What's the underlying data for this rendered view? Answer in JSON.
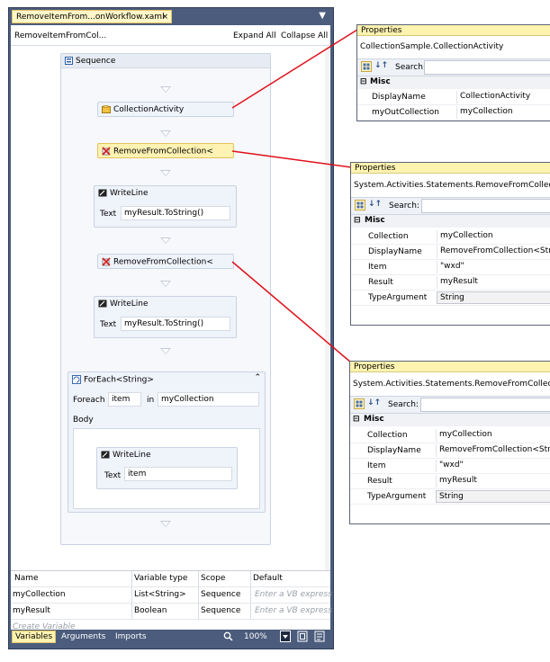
{
  "designer": {
    "tab_title": "RemoveItemFrom...onWorkflow.xaml",
    "tab_close": "×",
    "tab_dropdown": "▼",
    "breadcrumb": "RemoveItemFromCol...",
    "expand_all": "Expand All",
    "collapse_all": "Collapse All",
    "sequence_label": "Sequence",
    "activities": {
      "collection_activity": "CollectionActivity",
      "remove1": "RemoveFromCollection<",
      "writeline1": {
        "title": "WriteLine",
        "text_label": "Text",
        "text_value": "myResult.ToString()"
      },
      "remove2": "RemoveFromCollection<",
      "writeline2": {
        "title": "WriteLine",
        "text_label": "Text",
        "text_value": "myResult.ToString()"
      },
      "foreach": {
        "title": "ForEach<String>",
        "foreach_label": "Foreach",
        "item_value": "item",
        "in_label": "in",
        "collection_value": "myCollection",
        "body_label": "Body",
        "writeline": {
          "title": "WriteLine",
          "text_label": "Text",
          "text_value": "item"
        }
      }
    }
  },
  "variables": {
    "headers": [
      "Name",
      "Variable type",
      "Scope",
      "Default"
    ],
    "rows": [
      {
        "name": "myCollection",
        "type": "List<String>",
        "scope": "Sequence",
        "default": "Enter a VB express"
      },
      {
        "name": "myResult",
        "type": "Boolean",
        "scope": "Sequence",
        "default": "Enter a VB express"
      }
    ],
    "create_label": "Create Variable"
  },
  "bottom_bar": {
    "tabs": [
      "Variables",
      "Arguments",
      "Imports"
    ],
    "zoom": "100%"
  },
  "properties": [
    {
      "title": "Properties",
      "type": "CollectionSample.CollectionActivity",
      "search_label": "Search:",
      "category": "Misc",
      "rows": [
        {
          "name": "DisplayName",
          "value": "CollectionActivity"
        },
        {
          "name": "myOutCollection",
          "value": "myCollection"
        }
      ]
    },
    {
      "title": "Properties",
      "type": "System.Activities.Statements.RemoveFromCollection",
      "search_label": "Search:",
      "category": "Misc",
      "rows": [
        {
          "name": "Collection",
          "value": "myCollection"
        },
        {
          "name": "DisplayName",
          "value": "RemoveFromCollection<String"
        },
        {
          "name": "Item",
          "value": "\"wxd\""
        },
        {
          "name": "Result",
          "value": "myResult"
        },
        {
          "name": "TypeArgument",
          "value": "String"
        }
      ]
    },
    {
      "title": "Properties",
      "type": "System.Activities.Statements.RemoveFromCollection",
      "search_label": "Search:",
      "category": "Misc",
      "rows": [
        {
          "name": "Collection",
          "value": "myCollection"
        },
        {
          "name": "DisplayName",
          "value": "RemoveFromCollection<String"
        },
        {
          "name": "Item",
          "value": "\"wxd\""
        },
        {
          "name": "Result",
          "value": "myResult"
        },
        {
          "name": "TypeArgument",
          "value": "String"
        }
      ]
    }
  ],
  "colors": {
    "frame": "#4b5c7c",
    "callout_line": "#e0101a",
    "selected_activity": "#fff2b3",
    "header_yellow": "#fff3b0"
  }
}
